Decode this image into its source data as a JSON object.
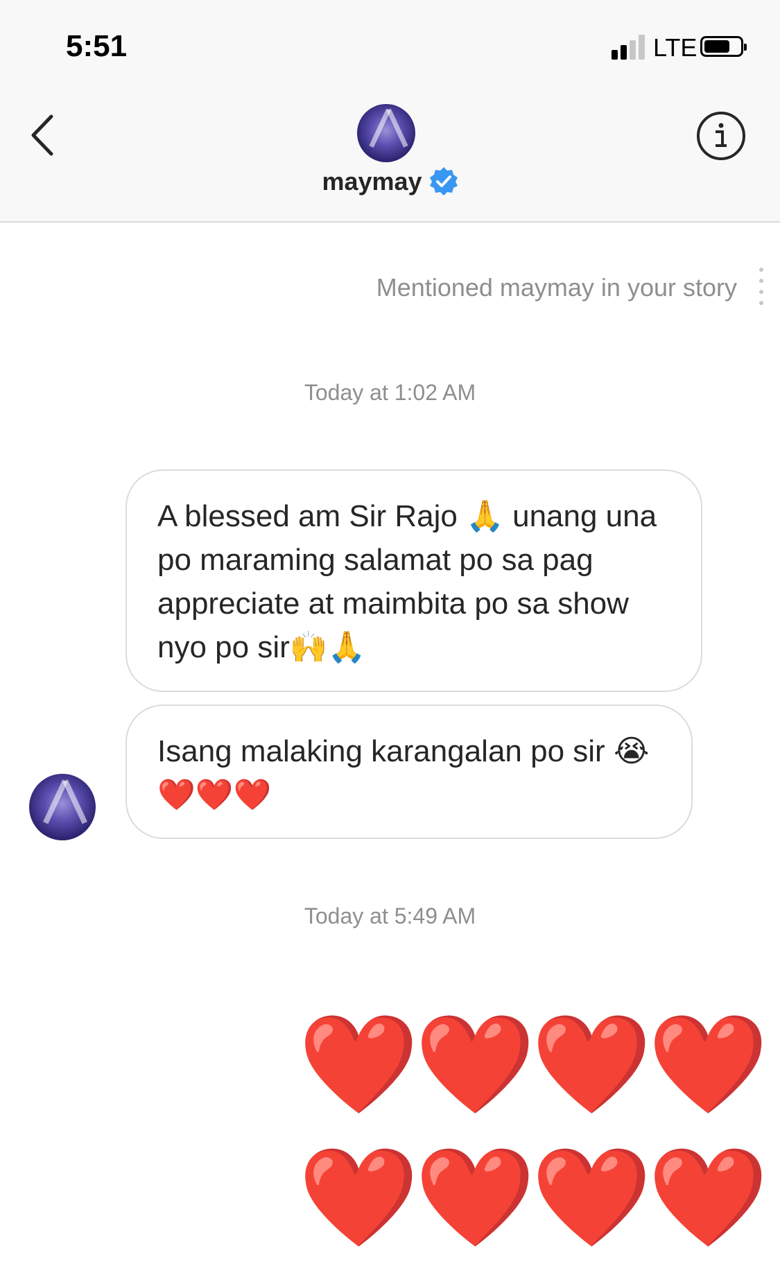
{
  "status_bar": {
    "time": "5:51",
    "network": "LTE",
    "signal_bars_active": 2,
    "signal_bars_total": 4,
    "battery_level": 0.72
  },
  "header": {
    "back_icon": "chevron-left-icon",
    "info_icon": "info-circle-icon",
    "username": "maymay",
    "verified_icon": "verified-badge-icon",
    "verified_color": "#3897f0"
  },
  "thread": {
    "story_mention": "Mentioned maymay in your story",
    "timestamp_1": "Today at 1:02 AM",
    "messages": [
      {
        "text": "A blessed am Sir Rajo 🙏 unang una po maraming salamat po sa pag appreciate at maimbita po sa show nyo po sir🙌🙏"
      },
      {
        "text": "Isang malaking karangalan po sir 😭❤️❤️❤️"
      }
    ],
    "timestamp_2": "Today at 5:49 AM",
    "hearts_message": [
      "❤️",
      "❤️",
      "❤️",
      "❤️",
      "❤️",
      "❤️",
      "❤️",
      "❤️"
    ]
  },
  "colors": {
    "header_bg": "#f8f8f8",
    "border": "#dbdbdb",
    "meta_text": "#8e8e8e",
    "text": "#262626",
    "heart": "#e53935"
  }
}
